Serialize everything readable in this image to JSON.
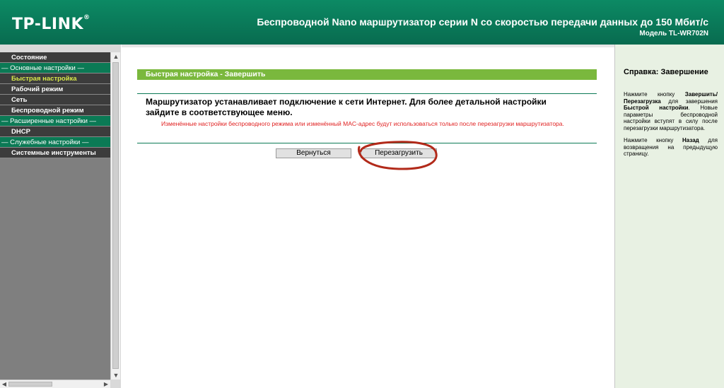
{
  "header": {
    "logo": "TP-LINK",
    "title": "Беспроводной Nano маршрутизатор серии N со скоростью передачи данных до 150 Мбит/с",
    "model": "Модель TL-WR702N"
  },
  "sidebar": {
    "items": [
      {
        "label": "Состояние",
        "type": "item"
      },
      {
        "label": "— Основные настройки —",
        "type": "section"
      },
      {
        "label": "Быстрая настройка",
        "type": "item",
        "active": true
      },
      {
        "label": "Рабочий режим",
        "type": "item"
      },
      {
        "label": "Сеть",
        "type": "item"
      },
      {
        "label": "Беспроводной режим",
        "type": "item"
      },
      {
        "label": "— Расширенные настройки —",
        "type": "section"
      },
      {
        "label": "DHCP",
        "type": "item"
      },
      {
        "label": "— Служебные настройки —",
        "type": "section"
      },
      {
        "label": "Системные инструменты",
        "type": "item"
      }
    ]
  },
  "main": {
    "title": "Быстрая настройка - Завершить",
    "message": "Маршрутизатор устанавливает подключение к сети Интернет. Для более детальной настройки зайдите в соответствующее меню.",
    "warning": "Изменённые настройки беспроводного режима или изменённый MAC-адрес будут использоваться только после перезагрузки маршрутизатора.",
    "back_button": "Вернуться",
    "reboot_button": "Перезагрузить"
  },
  "help": {
    "title": "Справка: Завершение",
    "p1_pre": "Нажмите кнопку ",
    "p1_bold1": "Завершить/Перезагрузка",
    "p1_mid": " для завершения ",
    "p1_bold2": "Быстрой настройки",
    "p1_post": ". Новые параметры беспроводной настройки вступят в силу после перезагрузки маршрутизатора.",
    "p2_pre": "Нажмите кнопку ",
    "p2_bold": "Назад",
    "p2_post": " для возвращения на предыдущую страницу."
  },
  "colors": {
    "header_green": "#0a7a5a",
    "title_bar_green": "#7ab83d",
    "active_menu_text": "#d7e84a",
    "warning_red": "#e02020",
    "annotation_circle": "#b22a1a"
  }
}
